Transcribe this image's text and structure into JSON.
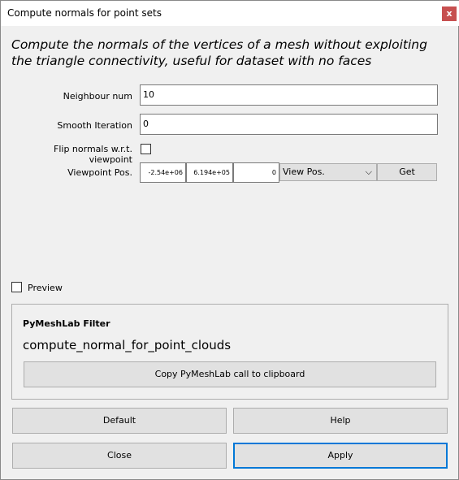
{
  "window": {
    "title": "Compute normals for point sets",
    "close": "x"
  },
  "description": "Compute the normals of the vertices of a mesh without exploiting the triangle connectivity, useful for dataset with no faces",
  "params": {
    "neighbour_label": "Neighbour num",
    "neighbour_value": "10",
    "smooth_label": "Smooth Iteration",
    "smooth_value": "0",
    "flip_label": "Flip normals w.r.t. viewpoint",
    "flip_checked": false,
    "viewpoint_label": "Viewpoint Pos.",
    "vx": "-2.54e+06",
    "vy": "6.194e+05",
    "vz": "0",
    "view_select": "View Pos.",
    "get": "Get"
  },
  "preview": {
    "label": "Preview",
    "checked": false
  },
  "pymeshlab": {
    "heading": "PyMeshLab Filter",
    "name": "compute_normal_for_point_clouds",
    "copy": "Copy PyMeshLab call to clipboard"
  },
  "buttons": {
    "default": "Default",
    "help": "Help",
    "close": "Close",
    "apply": "Apply"
  }
}
